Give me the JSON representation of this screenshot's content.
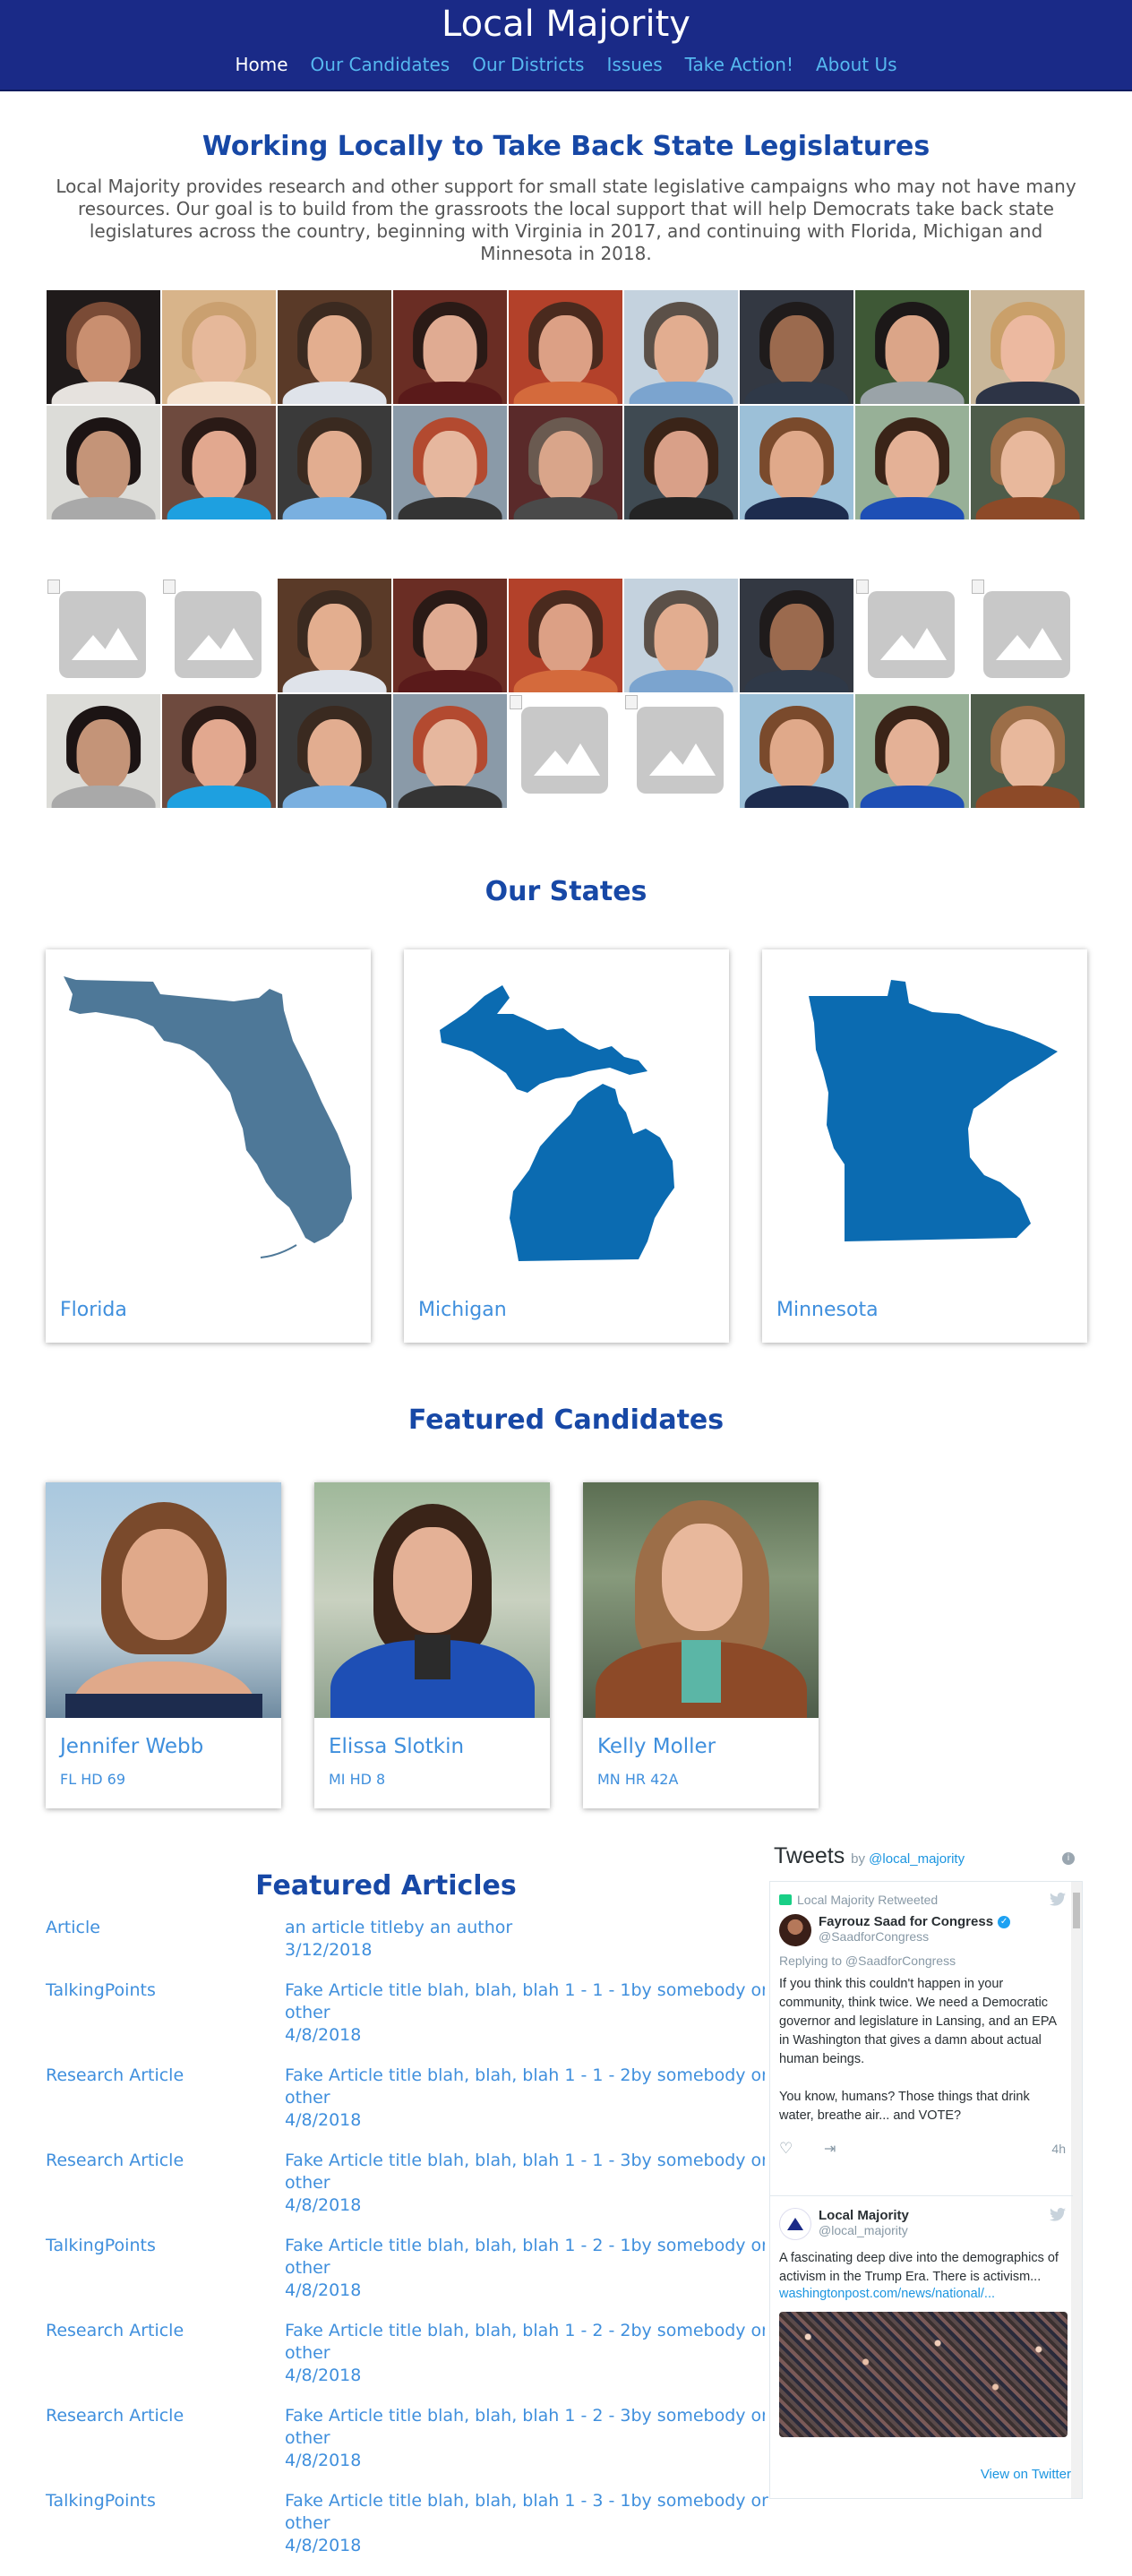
{
  "site": {
    "title": "Local Majority",
    "nav": [
      "Home",
      "Our Candidates",
      "Our Districts",
      "Issues",
      "Take Action!",
      "About Us"
    ]
  },
  "hero": {
    "heading": "Working Locally to Take Back State Legislatures",
    "intro": "Local Majority provides research and other support for small state legislative campaigns who may not have many resources. Our goal is to build from the grassroots the local support that will help Democrats take back state legislatures across the country, beginning with Virginia in 2017, and continuing with Florida, Michigan and Minnesota in 2018."
  },
  "states": {
    "heading": "Our States",
    "items": [
      {
        "name": "Florida",
        "color": "#4e7898"
      },
      {
        "name": "Michigan",
        "color": "#0b6bb1"
      },
      {
        "name": "Minnesota",
        "color": "#0b6bb1"
      }
    ]
  },
  "featured_candidates": {
    "heading": "Featured Candidates",
    "items": [
      {
        "name": "Jennifer Webb",
        "district": "FL HD 69"
      },
      {
        "name": "Elissa Slotkin",
        "district": "MI HD 8"
      },
      {
        "name": "Kelly Moller",
        "district": "MN HR 42A"
      }
    ]
  },
  "featured_articles": {
    "heading": "Featured Articles",
    "items": [
      {
        "type": "Article",
        "title": "an article titleby an author",
        "date": "3/12/2018"
      },
      {
        "type": "TalkingPoints",
        "title": "Fake Article title blah, blah, blah 1 - 1 - 1by somebody or other",
        "date": "4/8/2018"
      },
      {
        "type": "Research Article",
        "title": "Fake Article title blah, blah, blah 1 - 1 - 2by somebody or other",
        "date": "4/8/2018"
      },
      {
        "type": "Research Article",
        "title": "Fake Article title blah, blah, blah 1 - 1 - 3by somebody or other",
        "date": "4/8/2018"
      },
      {
        "type": "TalkingPoints",
        "title": "Fake Article title blah, blah, blah 1 - 2 - 1by somebody or other",
        "date": "4/8/2018"
      },
      {
        "type": "Research Article",
        "title": "Fake Article title blah, blah, blah 1 - 2 - 2by somebody or other",
        "date": "4/8/2018"
      },
      {
        "type": "Research Article",
        "title": "Fake Article title blah, blah, blah 1 - 2 - 3by somebody or other",
        "date": "4/8/2018"
      },
      {
        "type": "TalkingPoints",
        "title": "Fake Article title blah, blah, blah 1 - 3 - 1by somebody or other",
        "date": "4/8/2018"
      }
    ]
  },
  "twitter": {
    "title": "Tweets",
    "by": "by",
    "handle": "@local_majority",
    "view_link": "View on Twitter",
    "tweet1": {
      "retweet_label": "Local Majority Retweeted",
      "name": "Fayrouz Saad for Congress",
      "handle": "@SaadforCongress",
      "reply_to": "Replying to @SaadforCongress",
      "text1": "If you think this couldn't happen in your community, think twice. We need a Democratic governor and legislature in Lansing, and an EPA in Washington that gives a damn about actual human beings.",
      "text2": "You know, humans? Those things that drink water, breathe air... and VOTE?",
      "time": "4h"
    },
    "tweet2": {
      "name": "Local Majority",
      "handle": "@local_majority",
      "text": "A fascinating deep dive into the demographics of activism in the Trump Era. There is activism...",
      "link": "washingtonpost.com/news/national/..."
    }
  }
}
